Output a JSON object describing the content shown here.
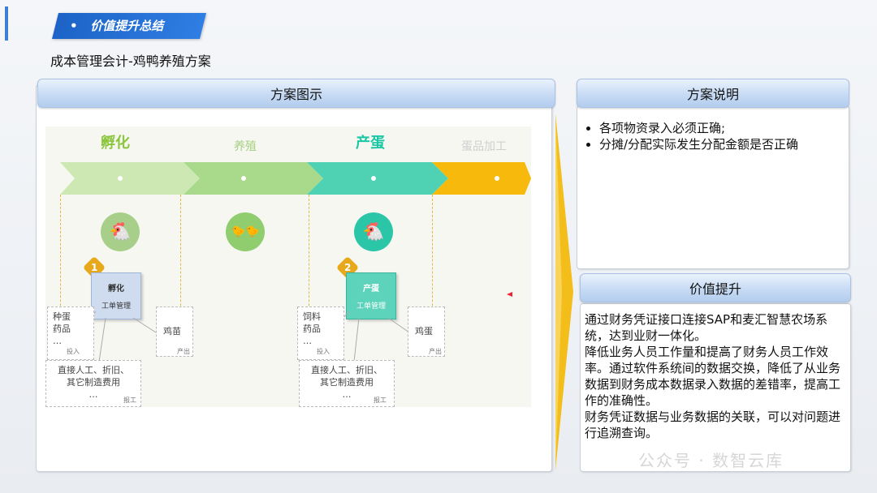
{
  "section": {
    "title": "价值提升总结",
    "bullet": "•"
  },
  "subtitle": "成本管理会计-鸡鸭养殖方案",
  "diagram_panel": {
    "header": "方案图示"
  },
  "explain_panel": {
    "header": "方案说明",
    "items": [
      "各项物资录入必须正确;",
      "分摊/分配实际发生分配金额是否正确"
    ]
  },
  "value_panel": {
    "header": "价值提升",
    "paragraphs": [
      "通过财务凭证接口连接SAP和麦汇智慧农场系统，达到业财一体化。",
      "降低业务人员工作量和提高了财务人员工作效率。通过软件系统间的数据交换，降低了从业务数据到财务成本数据录入数据的差错率，提高工作的准确性。",
      "财务凭证数据与业务数据的关联，可以对问题进行追溯查询。"
    ]
  },
  "diagram": {
    "phases": [
      "孵化",
      "养殖",
      "产蛋",
      "蛋品加工"
    ],
    "colors": {
      "phase_green": "#8cc63f",
      "phase_gray_green": "#a6cf80",
      "phase_teal": "#1bc7a5",
      "phase_gold": "#f4b400",
      "arrow1": "#cde8b3",
      "arrow2": "#a9d98a",
      "arrow3": "#4fd1b3",
      "arrow4": "#f6b90c"
    },
    "cards": [
      {
        "badge": "1",
        "title": "孵化",
        "sub": "工单管理"
      },
      {
        "badge": "2",
        "title": "产蛋",
        "sub": "工单管理"
      }
    ],
    "inputs": [
      {
        "lines": [
          "种蛋",
          "药品",
          "…"
        ],
        "tag": "投入"
      },
      {
        "lines": [
          "饲料",
          "药品",
          "…"
        ],
        "tag": "投入"
      }
    ],
    "outputs": [
      {
        "label": "鸡苗",
        "tag": "产出"
      },
      {
        "label": "鸡蛋",
        "tag": "产出"
      }
    ],
    "labor": [
      {
        "lines": [
          "直接人工、折旧、",
          "其它制造费用",
          "…"
        ],
        "tag": "报工"
      },
      {
        "lines": [
          "直接人工、折旧、",
          "其它制造费用",
          "…"
        ],
        "tag": "报工"
      }
    ],
    "icons": [
      "chicken-icon",
      "chicks-icon",
      "hen-eggs-icon"
    ]
  },
  "watermark": "公众号 · 数智云库"
}
